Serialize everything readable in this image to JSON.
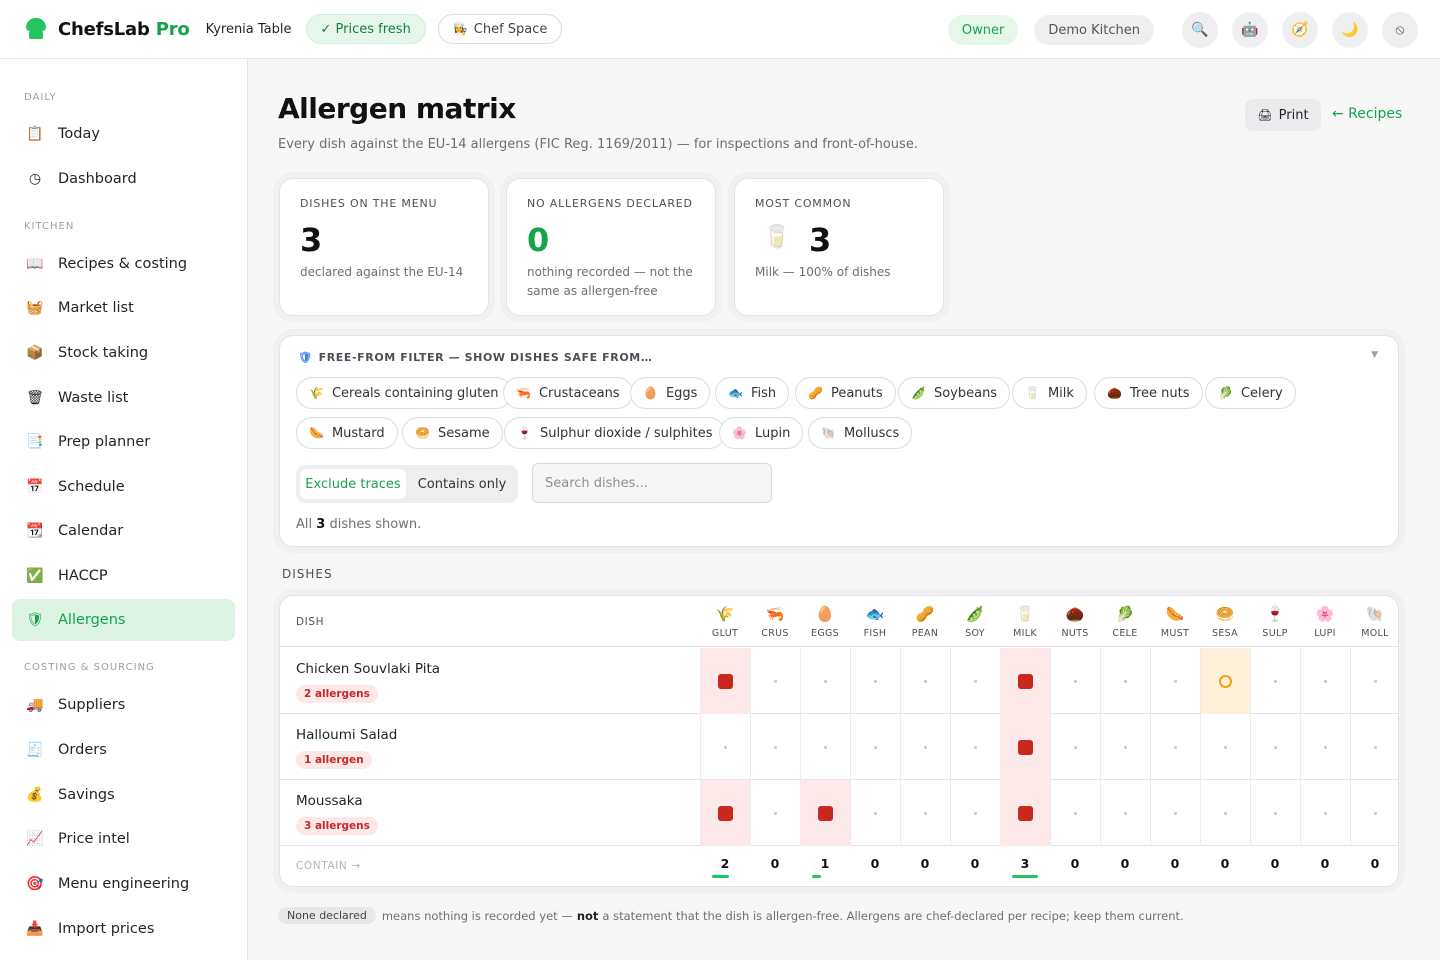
{
  "brand": {
    "name": "ChefsLab",
    "suffix": "Pro"
  },
  "header": {
    "venue": "Kyrenia Table",
    "prices_status": "✓ Prices fresh",
    "chef_space": "Chef Space",
    "role": "Owner",
    "workspace": "Demo Kitchen",
    "icons": [
      "search-icon",
      "robot-icon",
      "compass-icon",
      "moon-icon",
      "power-icon"
    ]
  },
  "sidebar": {
    "sections": [
      "Daily",
      "Kitchen",
      "Costing & sourcing"
    ],
    "items": [
      {
        "label": "Today",
        "icon": "clipboard-icon"
      },
      {
        "label": "Dashboard",
        "icon": "clock-icon"
      },
      {
        "label": "Recipes & costing",
        "icon": "book-icon"
      },
      {
        "label": "Market list",
        "icon": "basket-icon"
      },
      {
        "label": "Stock taking",
        "icon": "box-icon"
      },
      {
        "label": "Waste list",
        "icon": "bin-icon"
      },
      {
        "label": "Prep planner",
        "icon": "checklist-icon"
      },
      {
        "label": "Schedule",
        "icon": "calendar-icon"
      },
      {
        "label": "Calendar",
        "icon": "calendar-grid-icon"
      },
      {
        "label": "HACCP",
        "icon": "check-icon"
      },
      {
        "label": "Allergens",
        "icon": "shield-icon",
        "active": true
      },
      {
        "label": "Suppliers",
        "icon": "truck-icon"
      },
      {
        "label": "Orders",
        "icon": "receipt-icon"
      },
      {
        "label": "Savings",
        "icon": "moneybag-icon"
      },
      {
        "label": "Price intel",
        "icon": "chart-icon"
      },
      {
        "label": "Menu engineering",
        "icon": "target-icon"
      },
      {
        "label": "Import prices",
        "icon": "import-icon"
      }
    ]
  },
  "page": {
    "title": "Allergen matrix",
    "subtitle": "Every dish against the EU-14 allergens (FIC Reg. 1169/2011) — for inspections and front-of-house.",
    "print_label": "Print",
    "back_label": "← Recipes"
  },
  "stats": [
    {
      "label": "Dishes on the menu",
      "value": "3",
      "desc": "declared against the EU-14"
    },
    {
      "label": "No allergens declared",
      "value": "0",
      "desc": "nothing recorded — not the same as allergen-free",
      "accent": "#16a34a"
    },
    {
      "label": "Most common",
      "value": "3",
      "desc": "Milk — 100% of dishes",
      "icon": "milk-glass-icon"
    }
  ],
  "filter": {
    "title": "Free-from filter — show dishes safe from…",
    "chips": [
      "Cereals containing gluten",
      "Crustaceans",
      "Eggs",
      "Fish",
      "Peanuts",
      "Soybeans",
      "Milk",
      "Tree nuts",
      "Celery",
      "Mustard",
      "Sesame",
      "Sulphur dioxide / sulphites",
      "Lupin",
      "Molluscs"
    ],
    "mode_on": "Exclude traces",
    "mode_off": "Contains only",
    "search_placeholder": "Search dishes...",
    "shown_pre": "All",
    "shown_count": "3",
    "shown_post": "dishes shown."
  },
  "matrix": {
    "section_label": "Dishes",
    "dish_header": "DISH",
    "columns": [
      "GLUT",
      "CRUS",
      "EGGS",
      "FISH",
      "PEAN",
      "SOY",
      "MILK",
      "NUTS",
      "CELE",
      "MUST",
      "SESA",
      "SULP",
      "LUPI",
      "MOLL"
    ],
    "column_icons": [
      "wheat-icon",
      "shrimp-icon",
      "egg-icon",
      "fish-icon",
      "peanut-icon",
      "soy-icon",
      "milk-icon",
      "nut-icon",
      "celery-icon",
      "mustard-icon",
      "sesame-icon",
      "wine-icon",
      "lupin-icon",
      "mollusc-icon"
    ],
    "rows": [
      {
        "name": "Chicken Souvlaki Pita",
        "badge": "2 allergens",
        "cells": [
          "C",
          "",
          "",
          "",
          "",
          "",
          "C",
          "",
          "",
          "",
          "T",
          "",
          "",
          ""
        ]
      },
      {
        "name": "Halloumi Salad",
        "badge": "1 allergen",
        "cells": [
          "",
          "",
          "",
          "",
          "",
          "",
          "C",
          "",
          "",
          "",
          "",
          "",
          "",
          ""
        ]
      },
      {
        "name": "Moussaka",
        "badge": "3 allergens",
        "cells": [
          "C",
          "",
          "C",
          "",
          "",
          "",
          "C",
          "",
          "",
          "",
          "",
          "",
          "",
          ""
        ]
      }
    ],
    "footer_label": "Contain →",
    "totals": [
      2,
      0,
      1,
      0,
      0,
      0,
      3,
      0,
      0,
      0,
      0,
      0,
      0,
      0
    ]
  },
  "footnote": {
    "pill": "None declared",
    "pre": "means nothing is recorded yet —",
    "strong": "not",
    "post": "a statement that the dish is allergen-free. Allergens are chef-declared per recipe; keep them current."
  },
  "colors": {
    "accent": "#16a34a",
    "contains": "#c8281e",
    "trace": "#f59e0b"
  }
}
